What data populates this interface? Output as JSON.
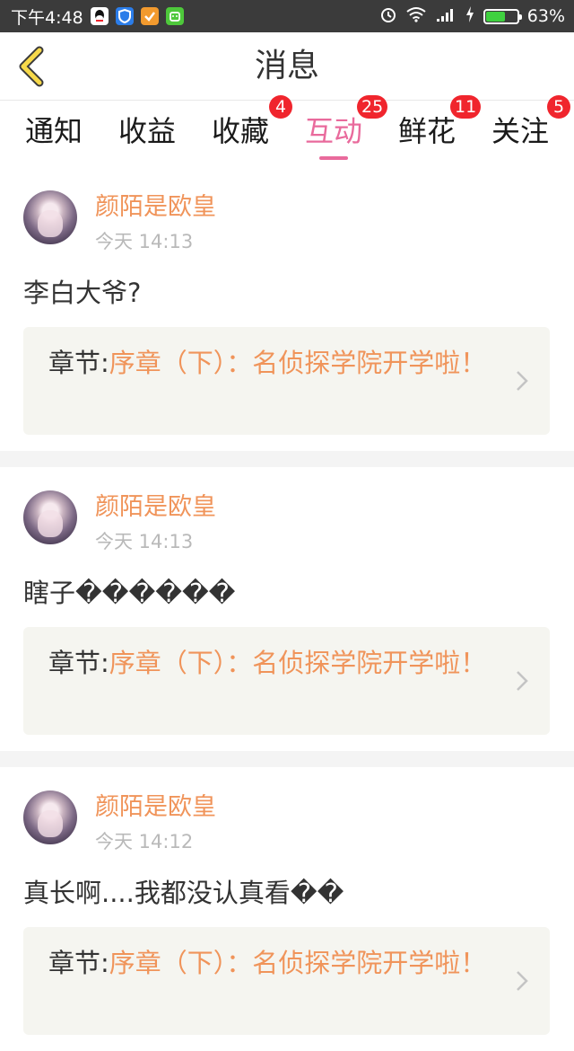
{
  "status_bar": {
    "time": "下午4:48",
    "battery": "63%",
    "battery_level": 0.63,
    "icons": [
      "qq-icon",
      "shield-icon",
      "checkmark-app-icon",
      "android-app-icon",
      "alarm-icon",
      "wifi-icon",
      "signal-icon",
      "charging-icon",
      "battery-icon"
    ]
  },
  "header": {
    "title": "消息",
    "back_icon": "chevron-left-icon"
  },
  "tabs": [
    {
      "label": "通知",
      "badge": null
    },
    {
      "label": "收益",
      "badge": null
    },
    {
      "label": "收藏",
      "badge": "4"
    },
    {
      "label": "互动",
      "badge": "25",
      "active": true
    },
    {
      "label": "鲜花",
      "badge": "11"
    },
    {
      "label": "关注",
      "badge": "5"
    }
  ],
  "colors": {
    "accent_pink": "#e96a9c",
    "username_orange": "#f0945a",
    "badge_red": "#f0252d"
  },
  "messages": [
    {
      "username": "颜陌是欧皇",
      "time": "今天 14:13",
      "comment": "李白大爷?",
      "chapter_prefix": "章节:",
      "chapter_title": "序章（下）：名侦探学院开学啦！"
    },
    {
      "username": "颜陌是欧皇",
      "time": "今天 14:13",
      "comment": "瞎子������",
      "chapter_prefix": "章节:",
      "chapter_title": "序章（下）：名侦探学院开学啦！"
    },
    {
      "username": "颜陌是欧皇",
      "time": "今天 14:12",
      "comment": "真长啊....我都没认真看��",
      "chapter_prefix": "章节:",
      "chapter_title": "序章（下）：名侦探学院开学啦！"
    }
  ]
}
